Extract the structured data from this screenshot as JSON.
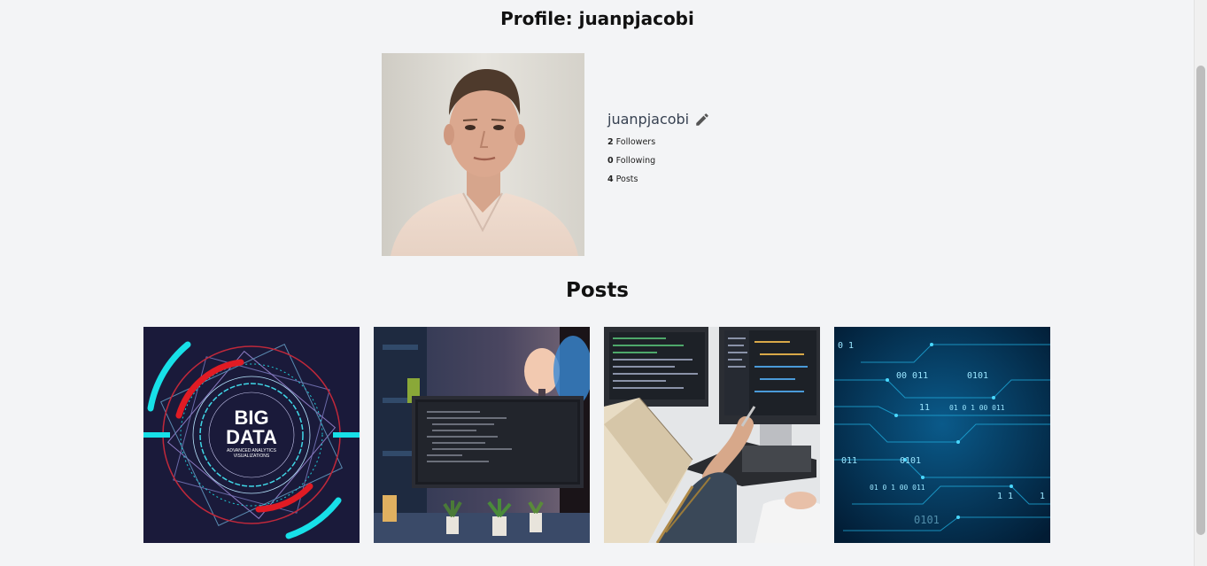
{
  "profile": {
    "title": "Profile: juanpjacobi",
    "username": "juanpjacobi",
    "stats": [
      {
        "count": "2",
        "label": "Followers"
      },
      {
        "count": "0",
        "label": "Following"
      },
      {
        "count": "4",
        "label": "Posts"
      }
    ]
  },
  "posts": {
    "title": "Posts",
    "items": [
      {
        "name": "post-big-data",
        "image_text_line1": "BIG",
        "image_text_line2": "DATA",
        "image_text_line3": "ADVANCED ANALYTICS",
        "image_text_line4": "VISUALIZATIONS"
      },
      {
        "name": "post-laptop-code"
      },
      {
        "name": "post-monitors-notebook"
      },
      {
        "name": "post-binary-circuit",
        "binary": [
          "00  011",
          "0101",
          "11",
          "01  0 1  00  011",
          "011",
          "0101",
          "1 1",
          "0 1",
          "01  0 1  00  011",
          "0101",
          "1"
        ]
      }
    ]
  },
  "colors": {
    "background": "#f3f4f6",
    "text": "#111111",
    "username": "#374151"
  }
}
